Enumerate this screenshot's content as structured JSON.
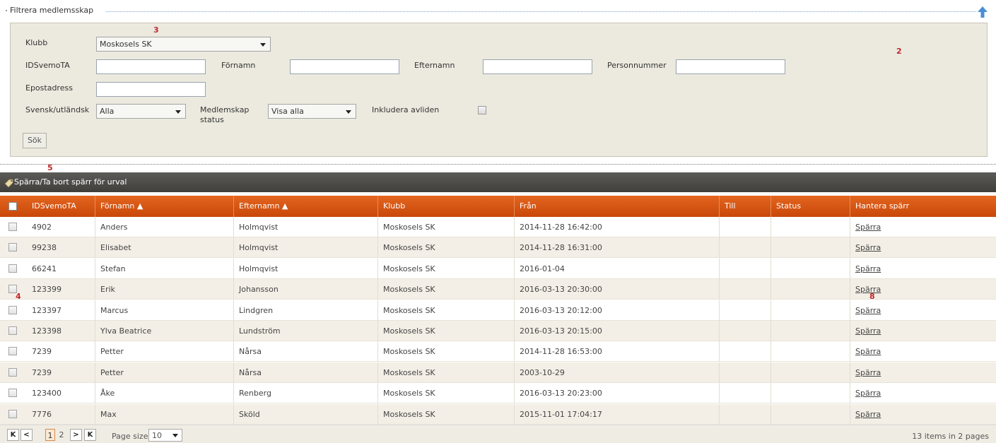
{
  "filter": {
    "legend": "Filtrera medlemsskap",
    "labels": {
      "klubb": "Klubb",
      "idsvemota": "IDSvemoTA",
      "fornamn": "Förnamn",
      "efternamn": "Efternamn",
      "personnummer": "Personnummer",
      "epost": "Epostadress",
      "svensk": "Svensk/utländsk",
      "medlemskap": "Medlemskap status",
      "avliden": "Inkludera avliden"
    },
    "values": {
      "klubb": "Moskosels SK",
      "svensk": "Alla",
      "medlemskap": "Visa alla",
      "idsvemota": "",
      "fornamn": "",
      "efternamn": "",
      "personnummer": "",
      "epost": "",
      "avliden": false
    },
    "search_button": "Sök"
  },
  "markers": {
    "m2": "2",
    "m3": "3",
    "m4": "4",
    "m5": "5",
    "m8": "8"
  },
  "toolbar": {
    "label": "Spärra/Ta bort spärr för urval"
  },
  "grid": {
    "columns": [
      "IDSvemoTA",
      "Förnamn ▲",
      "Efternamn ▲",
      "Klubb",
      "Från",
      "Till",
      "Status",
      "Hantera spärr"
    ],
    "rows": [
      {
        "id": "4902",
        "fornamn": "Anders",
        "efternamn": "Holmqvist",
        "klubb": "Moskosels SK",
        "fran": "2014-11-28 16:42:00",
        "till": "",
        "status": "",
        "action": "Spärra"
      },
      {
        "id": "99238",
        "fornamn": "Elisabet",
        "efternamn": "Holmqvist",
        "klubb": "Moskosels SK",
        "fran": "2014-11-28 16:31:00",
        "till": "",
        "status": "",
        "action": "Spärra"
      },
      {
        "id": "66241",
        "fornamn": "Stefan",
        "efternamn": "Holmqvist",
        "klubb": "Moskosels SK",
        "fran": "2016-01-04",
        "till": "",
        "status": "",
        "action": "Spärra"
      },
      {
        "id": "123399",
        "fornamn": "Erik",
        "efternamn": "Johansson",
        "klubb": "Moskosels SK",
        "fran": "2016-03-13 20:30:00",
        "till": "",
        "status": "",
        "action": "Spärra"
      },
      {
        "id": "123397",
        "fornamn": "Marcus",
        "efternamn": "Lindgren",
        "klubb": "Moskosels SK",
        "fran": "2016-03-13 20:12:00",
        "till": "",
        "status": "",
        "action": "Spärra"
      },
      {
        "id": "123398",
        "fornamn": "Ylva Beatrice",
        "efternamn": "Lundström",
        "klubb": "Moskosels SK",
        "fran": "2016-03-13 20:15:00",
        "till": "",
        "status": "",
        "action": "Spärra"
      },
      {
        "id": "7239",
        "fornamn": "Petter",
        "efternamn": "Nårsa",
        "klubb": "Moskosels SK",
        "fran": "2014-11-28 16:53:00",
        "till": "",
        "status": "",
        "action": "Spärra"
      },
      {
        "id": "7239",
        "fornamn": "Petter",
        "efternamn": "Nårsa",
        "klubb": "Moskosels SK",
        "fran": "2003-10-29",
        "till": "",
        "status": "",
        "action": "Spärra"
      },
      {
        "id": "123400",
        "fornamn": "Åke",
        "efternamn": "Renberg",
        "klubb": "Moskosels SK",
        "fran": "2016-03-13 20:23:00",
        "till": "",
        "status": "",
        "action": "Spärra"
      },
      {
        "id": "7776",
        "fornamn": "Max",
        "efternamn": "Sköld",
        "klubb": "Moskosels SK",
        "fran": "2015-11-01 17:04:17",
        "till": "",
        "status": "",
        "action": "Spärra"
      }
    ]
  },
  "pager": {
    "first": "K",
    "prev": "<",
    "next": ">",
    "last": "K",
    "pages": [
      "1",
      "2"
    ],
    "current_page": "1",
    "page_size_label": "Page size:",
    "page_size": "10",
    "info": "13 items in 2 pages"
  },
  "colors": {
    "header_orange": "#d9571a",
    "toolbar_dark": "#4a4946",
    "filter_bg": "#eceadf"
  }
}
